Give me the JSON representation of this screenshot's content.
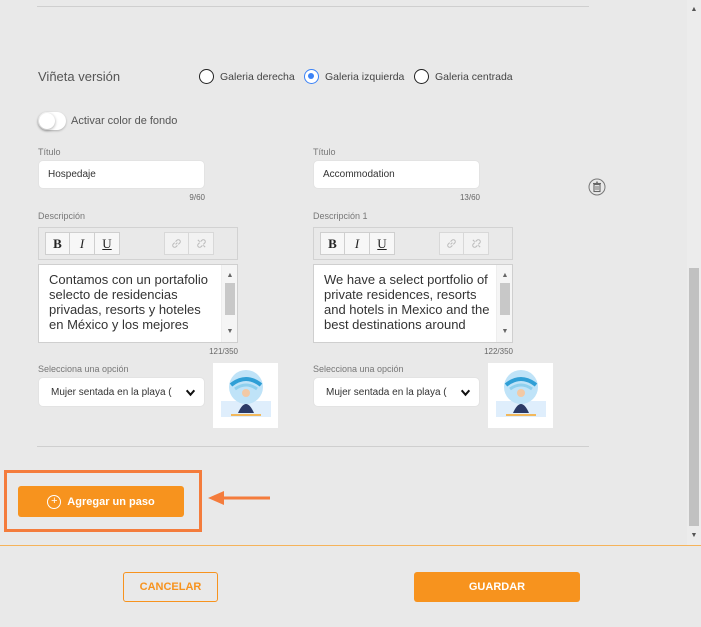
{
  "vineta": {
    "label": "Viñeta versión",
    "options": [
      {
        "label": "Galeria derecha",
        "checked": false
      },
      {
        "label": "Galeria izquierda",
        "checked": true
      },
      {
        "label": "Galeria centrada",
        "checked": false
      }
    ]
  },
  "background_toggle": {
    "label": "Activar color de fondo",
    "on": false
  },
  "left": {
    "title_label": "Título",
    "title_value": "Hospedaje",
    "title_counter": "9/60",
    "description_label": "Descripción",
    "description_text": "Contamos con un portafolio selecto de residencias privadas, resorts y hoteles en México y los mejores",
    "description_counter": "121/350",
    "select_label": "Selecciona una opción",
    "select_value": "Mujer sentada en la playa (",
    "image_name": "beach-woman-illustration"
  },
  "right": {
    "title_label": "Título",
    "title_value": "Accommodation",
    "title_counter": "13/60",
    "description_label": "Descripción 1",
    "description_text": "We have a select portfolio of private residences, resorts and hotels in Mexico and the best destinations around",
    "description_counter": "122/350",
    "select_label": "Selecciona una opción",
    "select_value": "Mujer sentada en la playa (",
    "image_name": "beach-woman-illustration"
  },
  "toolbar": {
    "bold": "B",
    "italic": "I",
    "underline": "U"
  },
  "add_step": {
    "label": "Agregar un paso",
    "icon": "plus-circle-icon"
  },
  "footer": {
    "cancel": "CANCELAR",
    "save": "GUARDAR"
  },
  "colors": {
    "accent": "#f7931e",
    "highlight": "#f47c3c",
    "radio_selected": "#3b82f6"
  }
}
